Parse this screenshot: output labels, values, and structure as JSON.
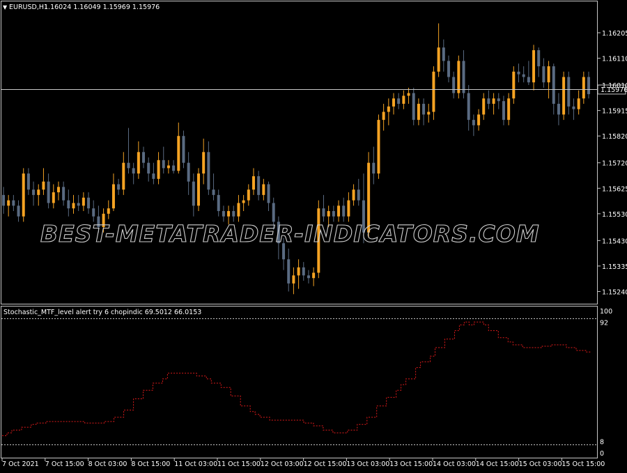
{
  "main": {
    "symbol_label": "EURUSD,H1",
    "ohlc_label": "1.16024 1.16049 1.15969 1.15976",
    "price_ticks": [
      "1.16205",
      "1.16110",
      "1.16010",
      "1.15915",
      "1.15820",
      "1.15720",
      "1.15625",
      "1.15530",
      "1.15430",
      "1.15335",
      "1.15240"
    ],
    "current_price_label": "1.15976"
  },
  "indicator": {
    "title": "Stochastic_MTF_level alert try 6 chopindic 69.5012 66.0153",
    "scale_ticks": [
      "100",
      "92",
      "8",
      "0"
    ]
  },
  "time_axis": [
    "7 Oct 2021",
    "7 Oct 15:00",
    "8 Oct 03:00",
    "8 Oct 15:00",
    "11 Oct 03:00",
    "11 Oct 15:00",
    "12 Oct 03:00",
    "12 Oct 15:00",
    "13 Oct 03:00",
    "13 Oct 15:00",
    "14 Oct 03:00",
    "14 Oct 15:00",
    "15 Oct 03:00",
    "15 Oct 15:00"
  ],
  "watermark": "BEST-METATRADER-INDICATORS.COM",
  "colors": {
    "bull": "#f5a323",
    "bear": "#5a6b82",
    "stoch_line": "#e01b1b",
    "level_line": "#c8c8c8",
    "grid_border": "#c8c8c8"
  },
  "chart_data": [
    {
      "type": "candlestick",
      "title": "EURUSD,H1",
      "ylim": [
        1.1521,
        1.1627
      ],
      "candles": [
        {
          "o": 1.156,
          "h": 1.1563,
          "l": 1.1553,
          "c": 1.1556
        },
        {
          "o": 1.1556,
          "h": 1.156,
          "l": 1.1552,
          "c": 1.1558
        },
        {
          "o": 1.1558,
          "h": 1.156,
          "l": 1.1554,
          "c": 1.1556
        },
        {
          "o": 1.1556,
          "h": 1.1558,
          "l": 1.155,
          "c": 1.1552
        },
        {
          "o": 1.1552,
          "h": 1.157,
          "l": 1.155,
          "c": 1.1568
        },
        {
          "o": 1.1568,
          "h": 1.157,
          "l": 1.156,
          "c": 1.1562
        },
        {
          "o": 1.1562,
          "h": 1.1565,
          "l": 1.1556,
          "c": 1.156
        },
        {
          "o": 1.156,
          "h": 1.1564,
          "l": 1.1556,
          "c": 1.1562
        },
        {
          "o": 1.1562,
          "h": 1.157,
          "l": 1.156,
          "c": 1.1565
        },
        {
          "o": 1.1565,
          "h": 1.1568,
          "l": 1.1555,
          "c": 1.1557
        },
        {
          "o": 1.1557,
          "h": 1.1564,
          "l": 1.1555,
          "c": 1.1561
        },
        {
          "o": 1.1561,
          "h": 1.1565,
          "l": 1.1558,
          "c": 1.1563
        },
        {
          "o": 1.1563,
          "h": 1.1565,
          "l": 1.1556,
          "c": 1.1558
        },
        {
          "o": 1.1558,
          "h": 1.1562,
          "l": 1.1552,
          "c": 1.1555
        },
        {
          "o": 1.1555,
          "h": 1.156,
          "l": 1.1553,
          "c": 1.1557
        },
        {
          "o": 1.1557,
          "h": 1.156,
          "l": 1.1554,
          "c": 1.1556
        },
        {
          "o": 1.1556,
          "h": 1.1561,
          "l": 1.1554,
          "c": 1.1559
        },
        {
          "o": 1.1559,
          "h": 1.1561,
          "l": 1.1553,
          "c": 1.1555
        },
        {
          "o": 1.1555,
          "h": 1.1558,
          "l": 1.155,
          "c": 1.1552
        },
        {
          "o": 1.1552,
          "h": 1.1556,
          "l": 1.1546,
          "c": 1.1548
        },
        {
          "o": 1.1548,
          "h": 1.1555,
          "l": 1.1546,
          "c": 1.1553
        },
        {
          "o": 1.1553,
          "h": 1.1558,
          "l": 1.1551,
          "c": 1.1555
        },
        {
          "o": 1.1555,
          "h": 1.1568,
          "l": 1.1554,
          "c": 1.1564
        },
        {
          "o": 1.1564,
          "h": 1.1566,
          "l": 1.156,
          "c": 1.1562
        },
        {
          "o": 1.1562,
          "h": 1.1576,
          "l": 1.156,
          "c": 1.1572
        },
        {
          "o": 1.1572,
          "h": 1.1585,
          "l": 1.1568,
          "c": 1.157
        },
        {
          "o": 1.157,
          "h": 1.1572,
          "l": 1.1564,
          "c": 1.1568
        },
        {
          "o": 1.1568,
          "h": 1.158,
          "l": 1.1566,
          "c": 1.1576
        },
        {
          "o": 1.1576,
          "h": 1.1578,
          "l": 1.157,
          "c": 1.1572
        },
        {
          "o": 1.1572,
          "h": 1.1574,
          "l": 1.1565,
          "c": 1.1568
        },
        {
          "o": 1.1568,
          "h": 1.1572,
          "l": 1.1564,
          "c": 1.1566
        },
        {
          "o": 1.1566,
          "h": 1.1576,
          "l": 1.1564,
          "c": 1.1573
        },
        {
          "o": 1.1573,
          "h": 1.1578,
          "l": 1.1568,
          "c": 1.157
        },
        {
          "o": 1.157,
          "h": 1.1573,
          "l": 1.1568,
          "c": 1.1571
        },
        {
          "o": 1.1571,
          "h": 1.1573,
          "l": 1.1568,
          "c": 1.1569
        },
        {
          "o": 1.1569,
          "h": 1.1587,
          "l": 1.1568,
          "c": 1.1582
        },
        {
          "o": 1.1582,
          "h": 1.1584,
          "l": 1.157,
          "c": 1.1572
        },
        {
          "o": 1.1572,
          "h": 1.1576,
          "l": 1.156,
          "c": 1.1565
        },
        {
          "o": 1.1565,
          "h": 1.1568,
          "l": 1.1552,
          "c": 1.1556
        },
        {
          "o": 1.1556,
          "h": 1.157,
          "l": 1.1554,
          "c": 1.1568
        },
        {
          "o": 1.1568,
          "h": 1.1581,
          "l": 1.1564,
          "c": 1.1576
        },
        {
          "o": 1.1576,
          "h": 1.158,
          "l": 1.156,
          "c": 1.1562
        },
        {
          "o": 1.1562,
          "h": 1.1568,
          "l": 1.1558,
          "c": 1.156
        },
        {
          "o": 1.156,
          "h": 1.1562,
          "l": 1.1552,
          "c": 1.1554
        },
        {
          "o": 1.1554,
          "h": 1.1556,
          "l": 1.155,
          "c": 1.1552
        },
        {
          "o": 1.1552,
          "h": 1.1556,
          "l": 1.1549,
          "c": 1.1554
        },
        {
          "o": 1.1554,
          "h": 1.1556,
          "l": 1.155,
          "c": 1.1552
        },
        {
          "o": 1.1552,
          "h": 1.156,
          "l": 1.155,
          "c": 1.1557
        },
        {
          "o": 1.1557,
          "h": 1.156,
          "l": 1.1554,
          "c": 1.1558
        },
        {
          "o": 1.1558,
          "h": 1.1564,
          "l": 1.1556,
          "c": 1.1562
        },
        {
          "o": 1.1562,
          "h": 1.157,
          "l": 1.156,
          "c": 1.1567
        },
        {
          "o": 1.1567,
          "h": 1.1569,
          "l": 1.1558,
          "c": 1.156
        },
        {
          "o": 1.156,
          "h": 1.1566,
          "l": 1.1558,
          "c": 1.1564
        },
        {
          "o": 1.1564,
          "h": 1.1565,
          "l": 1.1554,
          "c": 1.1557
        },
        {
          "o": 1.1557,
          "h": 1.1559,
          "l": 1.1547,
          "c": 1.155
        },
        {
          "o": 1.155,
          "h": 1.1552,
          "l": 1.1536,
          "c": 1.1542
        },
        {
          "o": 1.1542,
          "h": 1.1544,
          "l": 1.1532,
          "c": 1.1536
        },
        {
          "o": 1.1536,
          "h": 1.154,
          "l": 1.1524,
          "c": 1.1527
        },
        {
          "o": 1.1527,
          "h": 1.1533,
          "l": 1.1523,
          "c": 1.153
        },
        {
          "o": 1.153,
          "h": 1.1536,
          "l": 1.1525,
          "c": 1.1533
        },
        {
          "o": 1.1533,
          "h": 1.1535,
          "l": 1.1528,
          "c": 1.153
        },
        {
          "o": 1.153,
          "h": 1.1532,
          "l": 1.1527,
          "c": 1.1529
        },
        {
          "o": 1.1529,
          "h": 1.1533,
          "l": 1.1526,
          "c": 1.1531
        },
        {
          "o": 1.1531,
          "h": 1.1558,
          "l": 1.1529,
          "c": 1.1555
        },
        {
          "o": 1.1555,
          "h": 1.156,
          "l": 1.155,
          "c": 1.1552
        },
        {
          "o": 1.1552,
          "h": 1.1556,
          "l": 1.1548,
          "c": 1.1554
        },
        {
          "o": 1.1554,
          "h": 1.1556,
          "l": 1.155,
          "c": 1.1552
        },
        {
          "o": 1.1552,
          "h": 1.1558,
          "l": 1.155,
          "c": 1.1556
        },
        {
          "o": 1.1556,
          "h": 1.1559,
          "l": 1.155,
          "c": 1.1552
        },
        {
          "o": 1.1552,
          "h": 1.1561,
          "l": 1.155,
          "c": 1.1558
        },
        {
          "o": 1.1558,
          "h": 1.1564,
          "l": 1.1556,
          "c": 1.1562
        },
        {
          "o": 1.1562,
          "h": 1.1566,
          "l": 1.1556,
          "c": 1.1558
        },
        {
          "o": 1.1558,
          "h": 1.1568,
          "l": 1.1542,
          "c": 1.1546
        },
        {
          "o": 1.1546,
          "h": 1.1576,
          "l": 1.1544,
          "c": 1.1572
        },
        {
          "o": 1.1572,
          "h": 1.1578,
          "l": 1.1564,
          "c": 1.1568
        },
        {
          "o": 1.1568,
          "h": 1.159,
          "l": 1.1566,
          "c": 1.1588
        },
        {
          "o": 1.1588,
          "h": 1.1594,
          "l": 1.1584,
          "c": 1.1591
        },
        {
          "o": 1.1591,
          "h": 1.1596,
          "l": 1.1586,
          "c": 1.1593
        },
        {
          "o": 1.1593,
          "h": 1.1598,
          "l": 1.159,
          "c": 1.1596
        },
        {
          "o": 1.1596,
          "h": 1.1598,
          "l": 1.1592,
          "c": 1.1594
        },
        {
          "o": 1.1594,
          "h": 1.1599,
          "l": 1.1592,
          "c": 1.1597
        },
        {
          "o": 1.1597,
          "h": 1.16,
          "l": 1.1594,
          "c": 1.1598
        },
        {
          "o": 1.1598,
          "h": 1.16,
          "l": 1.1586,
          "c": 1.1588
        },
        {
          "o": 1.1588,
          "h": 1.1596,
          "l": 1.1586,
          "c": 1.1594
        },
        {
          "o": 1.1594,
          "h": 1.1596,
          "l": 1.1586,
          "c": 1.159
        },
        {
          "o": 1.159,
          "h": 1.1594,
          "l": 1.1587,
          "c": 1.1591
        },
        {
          "o": 1.1591,
          "h": 1.1608,
          "l": 1.1588,
          "c": 1.1606
        },
        {
          "o": 1.1606,
          "h": 1.1624,
          "l": 1.1604,
          "c": 1.1615
        },
        {
          "o": 1.1615,
          "h": 1.1618,
          "l": 1.1606,
          "c": 1.161
        },
        {
          "o": 1.161,
          "h": 1.1612,
          "l": 1.1602,
          "c": 1.1604
        },
        {
          "o": 1.1604,
          "h": 1.1606,
          "l": 1.1596,
          "c": 1.1598
        },
        {
          "o": 1.1598,
          "h": 1.1612,
          "l": 1.1596,
          "c": 1.161
        },
        {
          "o": 1.161,
          "h": 1.1614,
          "l": 1.1596,
          "c": 1.1598
        },
        {
          "o": 1.1598,
          "h": 1.1601,
          "l": 1.1584,
          "c": 1.1588
        },
        {
          "o": 1.1588,
          "h": 1.159,
          "l": 1.1582,
          "c": 1.1586
        },
        {
          "o": 1.1586,
          "h": 1.1592,
          "l": 1.1584,
          "c": 1.159
        },
        {
          "o": 1.159,
          "h": 1.1598,
          "l": 1.1588,
          "c": 1.1596
        },
        {
          "o": 1.1596,
          "h": 1.1599,
          "l": 1.1592,
          "c": 1.1594
        },
        {
          "o": 1.1594,
          "h": 1.1598,
          "l": 1.159,
          "c": 1.1596
        },
        {
          "o": 1.1596,
          "h": 1.1598,
          "l": 1.1592,
          "c": 1.1595
        },
        {
          "o": 1.1595,
          "h": 1.1597,
          "l": 1.1586,
          "c": 1.1588
        },
        {
          "o": 1.1588,
          "h": 1.1598,
          "l": 1.1586,
          "c": 1.1596
        },
        {
          "o": 1.1596,
          "h": 1.1608,
          "l": 1.1594,
          "c": 1.1606
        },
        {
          "o": 1.1606,
          "h": 1.1609,
          "l": 1.1602,
          "c": 1.1605
        },
        {
          "o": 1.1605,
          "h": 1.1608,
          "l": 1.1602,
          "c": 1.1604
        },
        {
          "o": 1.1604,
          "h": 1.161,
          "l": 1.1601,
          "c": 1.1602
        },
        {
          "o": 1.1602,
          "h": 1.1616,
          "l": 1.1599,
          "c": 1.1614
        },
        {
          "o": 1.1614,
          "h": 1.1615,
          "l": 1.1604,
          "c": 1.1608
        },
        {
          "o": 1.1608,
          "h": 1.1611,
          "l": 1.16,
          "c": 1.1602
        },
        {
          "o": 1.1602,
          "h": 1.161,
          "l": 1.1596,
          "c": 1.1608
        },
        {
          "o": 1.1608,
          "h": 1.1609,
          "l": 1.159,
          "c": 1.1594
        },
        {
          "o": 1.1594,
          "h": 1.1598,
          "l": 1.1586,
          "c": 1.159
        },
        {
          "o": 1.159,
          "h": 1.1606,
          "l": 1.1588,
          "c": 1.1604
        },
        {
          "o": 1.1604,
          "h": 1.1606,
          "l": 1.159,
          "c": 1.1593
        },
        {
          "o": 1.1593,
          "h": 1.1596,
          "l": 1.1588,
          "c": 1.1592
        },
        {
          "o": 1.1592,
          "h": 1.1599,
          "l": 1.159,
          "c": 1.1596
        },
        {
          "o": 1.1596,
          "h": 1.1606,
          "l": 1.1594,
          "c": 1.1604
        },
        {
          "o": 1.1604,
          "h": 1.1606,
          "l": 1.1596,
          "c": 1.15976
        }
      ]
    },
    {
      "type": "line",
      "title": "Stochastic_MTF_level alert try 6 chopindic 69.5012 66.0153",
      "ylim": [
        0,
        100
      ],
      "levels": [
        92,
        8
      ],
      "values": [
        12,
        14,
        16,
        16,
        18,
        18,
        20,
        21,
        21,
        22,
        22,
        22,
        22,
        22,
        22,
        22,
        22,
        21,
        21,
        21,
        21,
        22,
        22,
        25,
        25,
        30,
        30,
        38,
        38,
        44,
        44,
        49,
        49,
        52,
        56,
        56,
        56,
        56,
        56,
        56,
        54,
        54,
        52,
        49,
        49,
        46,
        46,
        40,
        40,
        33,
        33,
        29,
        27,
        25,
        25,
        23,
        23,
        23,
        23,
        23,
        23,
        23,
        21,
        21,
        19,
        19,
        16,
        16,
        14,
        14,
        14,
        16,
        16,
        20,
        20,
        25,
        25,
        33,
        33,
        39,
        39,
        44,
        48,
        52,
        52,
        60,
        64,
        64,
        68,
        74,
        74,
        80,
        80,
        86,
        90,
        92,
        90,
        92,
        92,
        90,
        86,
        86,
        81,
        81,
        78,
        76,
        76,
        74,
        74,
        74,
        74,
        75,
        75,
        76,
        76,
        76,
        74,
        74,
        72,
        72,
        71,
        71
      ]
    }
  ]
}
